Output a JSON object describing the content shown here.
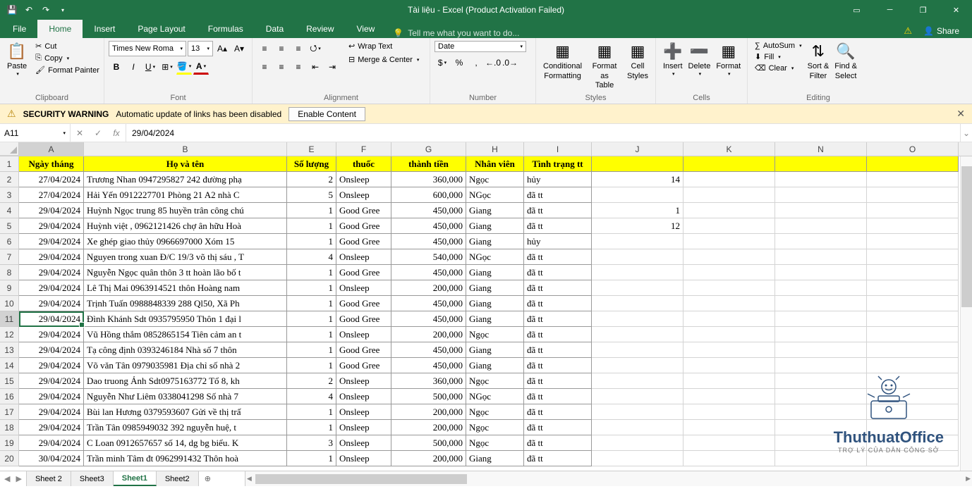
{
  "title": "Tài liệu - Excel (Product Activation Failed)",
  "qat": {
    "save": "💾",
    "undo": "↶",
    "redo": "↷"
  },
  "tabs": {
    "file": "File",
    "home": "Home",
    "insert": "Insert",
    "pageLayout": "Page Layout",
    "formulas": "Formulas",
    "data": "Data",
    "review": "Review",
    "view": "View",
    "tellMe": "Tell me what you want to do..."
  },
  "share": "Share",
  "ribbon": {
    "paste": "Paste",
    "cut": "Cut",
    "copy": "Copy",
    "formatPainter": "Format Painter",
    "clipboard": "Clipboard",
    "fontName": "Times New Roma",
    "fontSize": "13",
    "fontGroup": "Font",
    "wrapText": "Wrap Text",
    "mergeCenter": "Merge & Center",
    "alignment": "Alignment",
    "numberFormat": "Date",
    "numberGroup": "Number",
    "condFmt": "Conditional\nFormatting",
    "fmtTable": "Format as\nTable",
    "cellStyles": "Cell\nStyles",
    "styles": "Styles",
    "insert": "Insert",
    "delete": "Delete",
    "format": "Format",
    "cells": "Cells",
    "autoSum": "AutoSum",
    "fill": "Fill",
    "clear": "Clear",
    "sortFilter": "Sort &\nFilter",
    "findSelect": "Find &\nSelect",
    "editing": "Editing"
  },
  "security": {
    "title": "SECURITY WARNING",
    "msg": "Automatic update of links has been disabled",
    "enable": "Enable Content"
  },
  "nameBox": "A11",
  "formula": "29/04/2024",
  "columns": [
    "A",
    "B",
    "E",
    "F",
    "G",
    "H",
    "I",
    "J",
    "K",
    "N",
    "O"
  ],
  "headers": {
    "A": "Ngày tháng",
    "B": "Họ và tên",
    "E": "Số lượng",
    "F": "thuốc",
    "G": "thành tiền",
    "H": "Nhân viên",
    "I": "Tình trạng tt"
  },
  "rows": [
    {
      "n": 2,
      "A": "27/04/2024",
      "B": "Trương Nhan 0947295827 242 đường phạ",
      "E": "2",
      "F": "Onsleep",
      "G": "360,000",
      "H": "Ngọc",
      "I": "hủy",
      "J": "14"
    },
    {
      "n": 3,
      "A": "27/04/2024",
      "B": "Hải Yến 0912227701 Phòng 21 A2 nhà C",
      "E": "5",
      "F": "Onsleep",
      "G": "600,000",
      "H": "NGọc",
      "I": "đã tt",
      "J": ""
    },
    {
      "n": 4,
      "A": "29/04/2024",
      "B": "Huỳnh Ngọc trung 85 huyền trân công chú",
      "E": "1",
      "F": "Good Gree",
      "G": "450,000",
      "H": "Giang",
      "I": "đã tt",
      "J": "1"
    },
    {
      "n": 5,
      "A": "29/04/2024",
      "B": "Huỳnh việt , 0962121426 chợ ân hữu Hoà",
      "E": "1",
      "F": "Good Gree",
      "G": "450,000",
      "H": "Giang",
      "I": "đã tt",
      "J": "12"
    },
    {
      "n": 6,
      "A": "29/04/2024",
      "B": "Xe ghép giao thủy 0966697000 Xóm 15",
      "E": "1",
      "F": "Good Gree",
      "G": "450,000",
      "H": "Giang",
      "I": "hủy",
      "J": ""
    },
    {
      "n": 7,
      "A": "29/04/2024",
      "B": "Nguyen trong xuan Đ/C 19/3 võ thị sáu , T",
      "E": "4",
      "F": "Onsleep",
      "G": "540,000",
      "H": "NGọc",
      "I": "đã tt",
      "J": ""
    },
    {
      "n": 8,
      "A": "29/04/2024",
      "B": "Nguyễn Ngọc quân thôn 3 tt hoàn lão bố t",
      "E": "1",
      "F": "Good Gree",
      "G": "450,000",
      "H": "Giang",
      "I": "đã tt",
      "J": ""
    },
    {
      "n": 9,
      "A": "29/04/2024",
      "B": "Lê Thị Mai 0963914521 thôn Hoàng nam",
      "E": "1",
      "F": "Onsleep",
      "G": "200,000",
      "H": "Giang",
      "I": "đã tt",
      "J": ""
    },
    {
      "n": 10,
      "A": "29/04/2024",
      "B": "Trịnh Tuấn 0988848339 288 Ql50, Xã Ph",
      "E": "1",
      "F": "Good Gree",
      "G": "450,000",
      "H": "Giang",
      "I": "đã tt",
      "J": ""
    },
    {
      "n": 11,
      "A": "29/04/2024",
      "B": "Đình Khánh Sdt 0935795950 Thôn 1 đại l",
      "E": "1",
      "F": "Good Gree",
      "G": "450,000",
      "H": "Giang",
      "I": "đã tt",
      "J": ""
    },
    {
      "n": 12,
      "A": "29/04/2024",
      "B": "Vũ Hồng thắm 0852865154 Tiên cảm an t",
      "E": "1",
      "F": "Onsleep",
      "G": "200,000",
      "H": "Ngọc",
      "I": "đã tt",
      "J": ""
    },
    {
      "n": 13,
      "A": "29/04/2024",
      "B": "Tạ công định 0393246184 Nhà số 7 thôn",
      "E": "1",
      "F": "Good Gree",
      "G": "450,000",
      "H": "Giang",
      "I": "đã tt",
      "J": ""
    },
    {
      "n": 14,
      "A": "29/04/2024",
      "B": "Võ văn Tân 0979035981 Địa chỉ số nhà 2",
      "E": "1",
      "F": "Good Gree",
      "G": "450,000",
      "H": "Giang",
      "I": "đã tt",
      "J": ""
    },
    {
      "n": 15,
      "A": "29/04/2024",
      "B": "Dao truong Ảnh  Sdt0975163772 Tổ 8, kh",
      "E": "2",
      "F": "Onsleep",
      "G": "360,000",
      "H": "Ngọc",
      "I": "đã tt",
      "J": ""
    },
    {
      "n": 16,
      "A": "29/04/2024",
      "B": "Nguyễn Như Liêm 0338041298 Số nhà 7",
      "E": "4",
      "F": "Onsleep",
      "G": "500,000",
      "H": "NGọc",
      "I": "đã tt",
      "J": ""
    },
    {
      "n": 17,
      "A": "29/04/2024",
      "B": "Bùi lan Hương 0379593607 Gửi về thị trấ",
      "E": "1",
      "F": "Onsleep",
      "G": "200,000",
      "H": "Ngọc",
      "I": "đã tt",
      "J": ""
    },
    {
      "n": 18,
      "A": "29/04/2024",
      "B": "Trần Tân 0985949032 392  nguyễn huệ, t",
      "E": "1",
      "F": "Onsleep",
      "G": "200,000",
      "H": "Ngọc",
      "I": "đã tt",
      "J": ""
    },
    {
      "n": 19,
      "A": "29/04/2024",
      "B": "C Loan 0912657657 số 14, dg bg biểu. K",
      "E": "3",
      "F": "Onsleep",
      "G": "500,000",
      "H": "Ngọc",
      "I": "đã tt",
      "J": ""
    },
    {
      "n": 20,
      "A": "30/04/2024",
      "B": "Trần minh Tâm đt 0962991432 Thôn hoà",
      "E": "1",
      "F": "Onsleep",
      "G": "200,000",
      "H": "Giang",
      "I": "đã tt",
      "J": ""
    }
  ],
  "sheets": [
    "Sheet 2",
    "Sheet3",
    "Sheet1",
    "Sheet2"
  ],
  "activeSheet": "Sheet1",
  "watermark": {
    "title": "ThuthuatOffice",
    "sub": "TRỢ LÝ CỦA DÂN CÔNG SỞ"
  }
}
